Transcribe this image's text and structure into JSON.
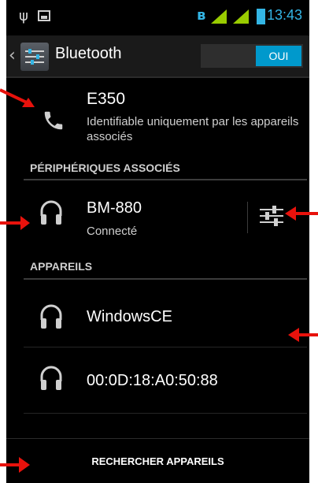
{
  "status_bar": {
    "usb_icon": "usb-icon",
    "image_icon": "image-icon",
    "bluetooth_icon": "bluetooth-icon",
    "signal_icons": [
      "signal-icon",
      "signal-icon"
    ],
    "battery_icon": "battery-icon",
    "time": "13:43",
    "accent_color": "#33b5e5",
    "signal_color": "#99cc00"
  },
  "action_bar": {
    "title": "Bluetooth",
    "toggle_label": "OUI",
    "toggle_color": "#0099cc"
  },
  "device": {
    "name": "E350",
    "description": "Identifiable uniquement par les appareils associés"
  },
  "paired_section": {
    "title": "PÉRIPHÉRIQUES ASSOCIÉS",
    "items": [
      {
        "name": "BM-880",
        "status": "Connecté"
      }
    ]
  },
  "devices_section": {
    "title": "APPAREILS",
    "items": [
      {
        "name": "WindowsCE"
      },
      {
        "name": "00:0D:18:A0:50:88"
      }
    ]
  },
  "footer": {
    "search_label": "RECHERCHER APPAREILS"
  },
  "annotation_color": "#e8120c"
}
